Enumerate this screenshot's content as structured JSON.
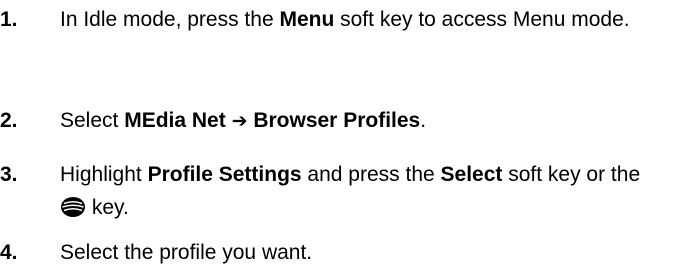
{
  "steps": [
    {
      "number": "1.",
      "t1": "In Idle mode, press the ",
      "b1": "Menu",
      "t2": " soft key to access Menu mode."
    },
    {
      "number": "2.",
      "t1": "Select ",
      "b1": "MEdia Net",
      "arrow": "➔",
      "b2": "Browser Profiles",
      "t2": "."
    },
    {
      "number": "3.",
      "t1": "Highlight ",
      "b1": "Profile Settings",
      "t2": " and press the ",
      "b2": "Select",
      "t3": " soft key or the ",
      "icon": "navigation-key-icon",
      "t4": " key."
    },
    {
      "number": "4.",
      "t1": "Select the profile you want."
    }
  ]
}
